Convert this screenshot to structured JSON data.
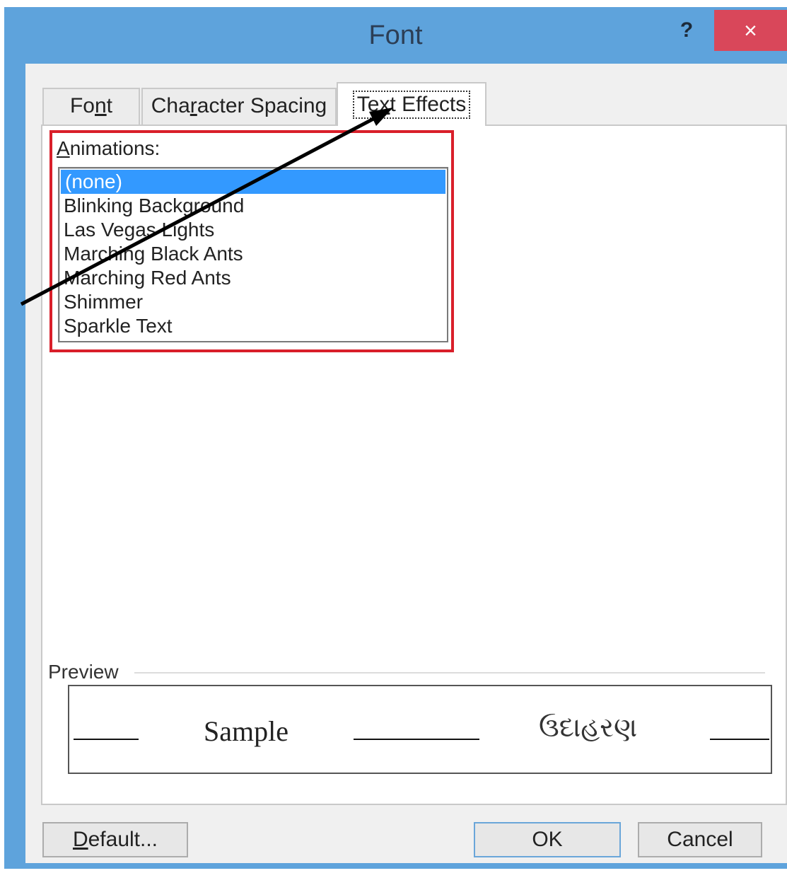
{
  "window": {
    "title": "Font",
    "help_label": "?",
    "close_label": "×"
  },
  "tabs": [
    {
      "label_pre": "Fo",
      "label_key": "n",
      "label_post": "t",
      "active": false
    },
    {
      "label_pre": "Cha",
      "label_key": "r",
      "label_post": "acter Spacing",
      "active": false
    },
    {
      "label_pre": "Te",
      "label_key": "x",
      "label_post": "t Effects",
      "active": true
    }
  ],
  "animations": {
    "label_key": "A",
    "label_rest": "nimations:",
    "items": [
      {
        "label": "(none)",
        "selected": true
      },
      {
        "label": "Blinking Background",
        "selected": false
      },
      {
        "label": "Las Vegas Lights",
        "selected": false
      },
      {
        "label": "Marching Black Ants",
        "selected": false
      },
      {
        "label": "Marching Red Ants",
        "selected": false
      },
      {
        "label": "Shimmer",
        "selected": false
      },
      {
        "label": "Sparkle Text",
        "selected": false
      }
    ]
  },
  "preview": {
    "label": "Preview",
    "sample_latin": "Sample",
    "sample_gujarati": "ઉદાહરણ"
  },
  "buttons": {
    "default_key": "D",
    "default_rest": "efault...",
    "ok": "OK",
    "cancel": "Cancel"
  },
  "colors": {
    "title_bar": "#5ea3dc",
    "close_button": "#d9475a",
    "selection": "#3399ff",
    "highlight_box": "#d91f2a"
  }
}
